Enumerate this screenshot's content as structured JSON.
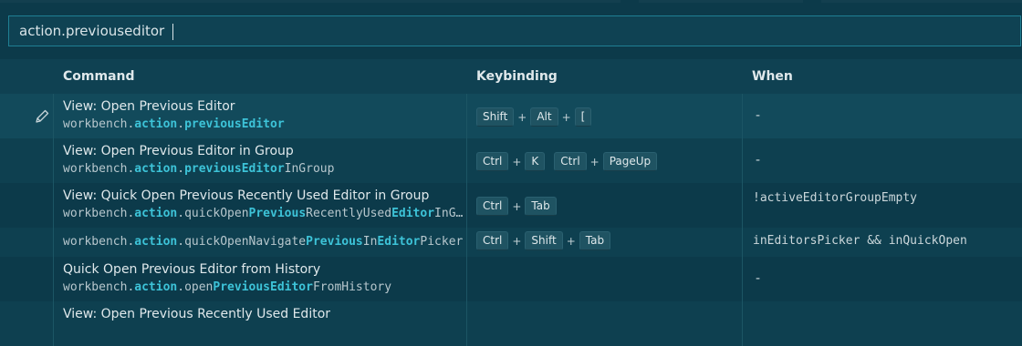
{
  "search": {
    "value": "action.previouseditor"
  },
  "columns": {
    "command": "Command",
    "keybinding": "Keybinding",
    "when": "When"
  },
  "rows": [
    {
      "title": "View: Open Previous Editor",
      "id_parts": [
        [
          "workbench.",
          false
        ],
        [
          "action",
          true
        ],
        [
          ".",
          false
        ],
        [
          "previousEditor",
          true
        ]
      ],
      "keys": [
        [
          "Shift",
          "Alt",
          "["
        ]
      ],
      "when": "-",
      "when_is_dash": true,
      "editing": true
    },
    {
      "title": "View: Open Previous Editor in Group",
      "id_parts": [
        [
          "workbench.",
          false
        ],
        [
          "action",
          true
        ],
        [
          ".",
          false
        ],
        [
          "previousEditor",
          true
        ],
        [
          "InGroup",
          false
        ]
      ],
      "keys": [
        [
          "Ctrl",
          "K"
        ],
        [
          "Ctrl",
          "PageUp"
        ]
      ],
      "when": "-",
      "when_is_dash": true
    },
    {
      "title": "View: Quick Open Previous Recently Used Editor in Group",
      "id_parts": [
        [
          "workbench.",
          false
        ],
        [
          "action",
          true
        ],
        [
          ".quickOpen",
          false
        ],
        [
          "Previous",
          true
        ],
        [
          "RecentlyUsed",
          false
        ],
        [
          "Editor",
          true
        ],
        [
          "InGroup",
          false
        ]
      ],
      "keys": [
        [
          "Ctrl",
          "Tab"
        ]
      ],
      "when": "!activeEditorGroupEmpty",
      "when_is_dash": false
    },
    {
      "title": "",
      "id_parts": [
        [
          "workbench.",
          false
        ],
        [
          "action",
          true
        ],
        [
          ".quickOpenNavigate",
          false
        ],
        [
          "Previous",
          true
        ],
        [
          "In",
          false
        ],
        [
          "Editor",
          true
        ],
        [
          "Picker",
          false
        ]
      ],
      "keys": [
        [
          "Ctrl",
          "Shift",
          "Tab"
        ]
      ],
      "when": "inEditorsPicker && inQuickOpen",
      "when_is_dash": false,
      "short": true
    },
    {
      "title": "Quick Open Previous Editor from History",
      "id_parts": [
        [
          "workbench.",
          false
        ],
        [
          "action",
          true
        ],
        [
          ".open",
          false
        ],
        [
          "PreviousEditor",
          true
        ],
        [
          "FromHistory",
          false
        ]
      ],
      "keys": [],
      "when": "-",
      "when_is_dash": true
    },
    {
      "title": "View: Open Previous Recently Used Editor",
      "id_parts": [],
      "keys": [],
      "when": "",
      "when_is_dash": false
    }
  ]
}
